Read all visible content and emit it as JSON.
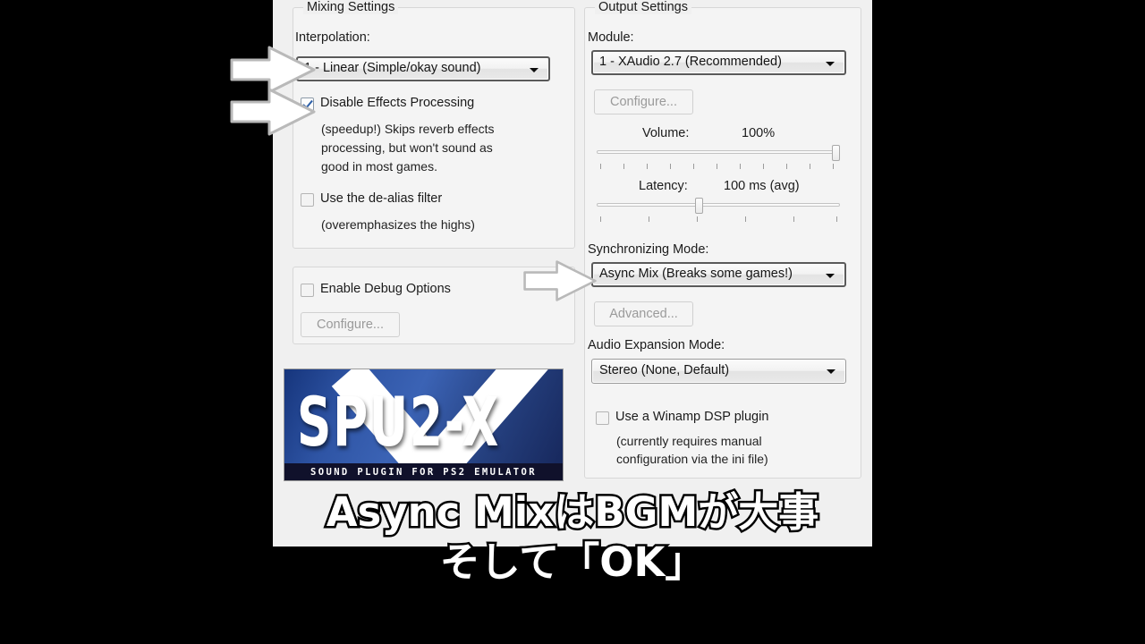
{
  "dialog": {
    "mixing": {
      "group_title": "Mixing Settings",
      "interpolation_label": "Interpolation:",
      "interpolation_value": "1 - Linear (Simple/okay sound)",
      "disable_effects_label": "Disable Effects Processing",
      "disable_effects_desc_1": "(speedup!) Skips reverb effects",
      "disable_effects_desc_2": "processing, but won't sound as",
      "disable_effects_desc_3": "good in most games.",
      "dealias_label": "Use the de-alias filter",
      "dealias_desc": "(overemphasizes the highs)"
    },
    "debug": {
      "enable_debug_label": "Enable Debug Options",
      "configure_label": "Configure..."
    },
    "logo": {
      "title": "SPU2-X",
      "tagline": "SOUND PLUGIN FOR PS2 EMULATOR"
    },
    "output": {
      "group_title": "Output Settings",
      "module_label": "Module:",
      "module_value": "1 - XAudio 2.7 (Recommended)",
      "configure_label": "Configure...",
      "volume_label": "Volume:",
      "volume_value": "100%",
      "latency_label": "Latency:",
      "latency_value": "100 ms (avg)",
      "sync_label": "Synchronizing Mode:",
      "sync_value": "Async Mix (Breaks some games!)",
      "advanced_label": "Advanced...",
      "expansion_label": "Audio Expansion Mode:",
      "expansion_value": "Stereo (None, Default)",
      "winamp_label": "Use a Winamp DSP plugin",
      "winamp_desc_1": "(currently requires manual",
      "winamp_desc_2": "configuration via the ini file)"
    }
  },
  "subtitles": {
    "line1": "Async MixはBGMが大事",
    "line2": "そして「OK」"
  },
  "colors": {
    "dialog_background": "#f0f0f0",
    "group_background": "#f4f4f4",
    "checkbox_check": "#2b5ea8",
    "logo_blue": "#2e54a4",
    "logo_bar": "#10112b"
  }
}
